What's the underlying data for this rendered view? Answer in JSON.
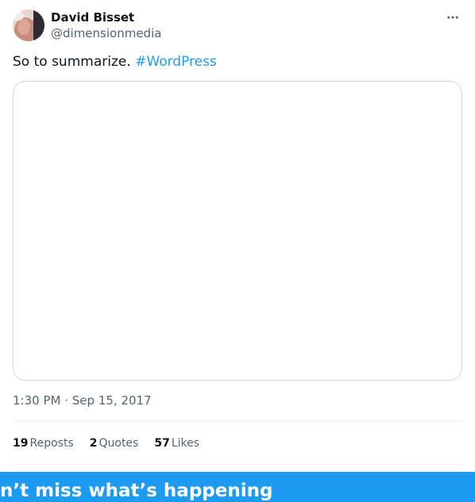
{
  "author": {
    "display_name": "David Bisset",
    "handle": "@dimensionmedia"
  },
  "tweet": {
    "text": "So to summarize.",
    "hashtag": "#WordPress",
    "timestamp": "1:30 PM · Sep 15, 2017"
  },
  "stats": [
    {
      "count": "19",
      "label": "Reposts"
    },
    {
      "count": "2",
      "label": "Quotes"
    },
    {
      "count": "57",
      "label": "Likes"
    }
  ],
  "banner": {
    "text": "n’t miss what’s happening"
  },
  "icons": {
    "more": "more-horizontal-icon"
  },
  "colors": {
    "accent": "#1d9bf0",
    "text_primary": "#0f1419",
    "text_secondary": "#536471",
    "border": "#cfd9de"
  }
}
